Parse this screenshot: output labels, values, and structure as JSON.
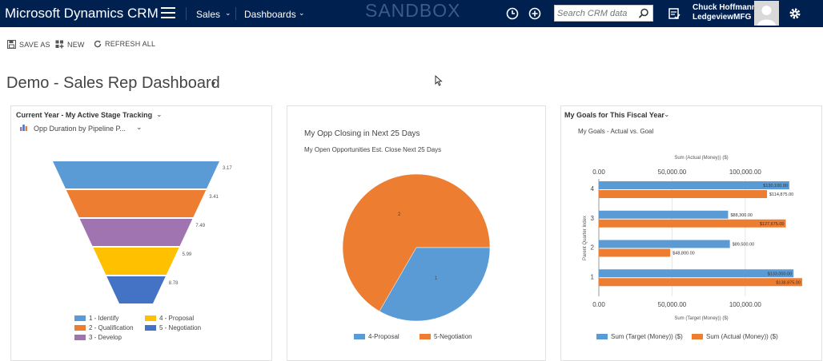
{
  "app": {
    "brand": "Microsoft Dynamics CRM",
    "nav_sales": "Sales",
    "nav_dashboards": "Dashboards",
    "environment_label": "SANDBOX",
    "search_placeholder": "Search CRM data",
    "user_name": "Chuck Hoffmann",
    "user_org": "LedgeviewMFG"
  },
  "toolbar": {
    "save_as": "SAVE AS",
    "new": "NEW",
    "refresh_all": "REFRESH ALL"
  },
  "page": {
    "title": "Demo - Sales Rep Dashboard"
  },
  "panels": {
    "stage": {
      "title": "Current Year - My Active Stage Tracking",
      "view_selector": "Opp Duration by Pipeline P..."
    },
    "closing": {
      "title": "My Opp Closing in Next 25 Days",
      "subtitle": "My Open Opportunities Est. Close Next 25 Days"
    },
    "goals": {
      "title": "My Goals for This Fiscal Year",
      "subtitle": "My Goals - Actual vs. Goal"
    }
  },
  "colors": {
    "nav_bg": "#002050",
    "identify": "#5b9bd5",
    "qualification": "#ed7d31",
    "develop": "#a074b0",
    "proposal": "#ffc000",
    "negotiation": "#4472c4",
    "blue": "#5b9bd5",
    "orange": "#ed7d31"
  },
  "icons": [
    "hamburger-icon",
    "clock-icon",
    "plus-icon",
    "search-icon",
    "task-icon",
    "gear-icon",
    "save-icon",
    "new-icon",
    "refresh-icon",
    "chevron-down-icon"
  ],
  "chart_data": [
    {
      "type": "funnel",
      "categories": [
        "1 - Identify",
        "2 - Qualification",
        "3 - Develop",
        "4 - Proposal",
        "5 - Negotiation"
      ],
      "values": [
        3.17,
        3.41,
        7.49,
        5.99,
        8.78
      ],
      "value_labels": [
        "3.17",
        "3.41",
        "7.49",
        "5.99",
        "8.78"
      ],
      "colors": [
        "#5b9bd5",
        "#ed7d31",
        "#a074b0",
        "#ffc000",
        "#4472c4"
      ],
      "legend_position": "bottom"
    },
    {
      "type": "pie",
      "categories": [
        "4-Proposal",
        "5-Negotiation"
      ],
      "values": [
        1,
        2
      ],
      "value_labels": [
        "1",
        "2"
      ],
      "colors": [
        "#5b9bd5",
        "#ed7d31"
      ],
      "legend_position": "bottom"
    },
    {
      "type": "bar",
      "orientation": "horizontal",
      "categories": [
        "4",
        "3",
        "2",
        "1"
      ],
      "ylabel": "Parent Quarter Index",
      "top_axis_label": "Sum (Actual (Money)) ($)",
      "bottom_axis_label": "Sum (Target (Money)) ($)",
      "ticks": [
        "0.00",
        "50,000.00",
        "100,000.00"
      ],
      "xlim": [
        0,
        140000
      ],
      "series": [
        {
          "name": "Sum (Target (Money)) ($)",
          "values": [
            130100,
            88300,
            89500,
            133000
          ],
          "labels": [
            "$130,100.00",
            "$88,300.00",
            "$89,500.00",
            "$133,000.00"
          ],
          "color": "#5b9bd5"
        },
        {
          "name": "Sum (Actual (Money)) ($)",
          "values": [
            114875,
            127675,
            48800,
            138875
          ],
          "labels": [
            "$114,875.00",
            "$127,675.00",
            "$48,800.00",
            "$138,875.00"
          ],
          "color": "#ed7d31"
        }
      ],
      "legend_position": "bottom"
    }
  ]
}
